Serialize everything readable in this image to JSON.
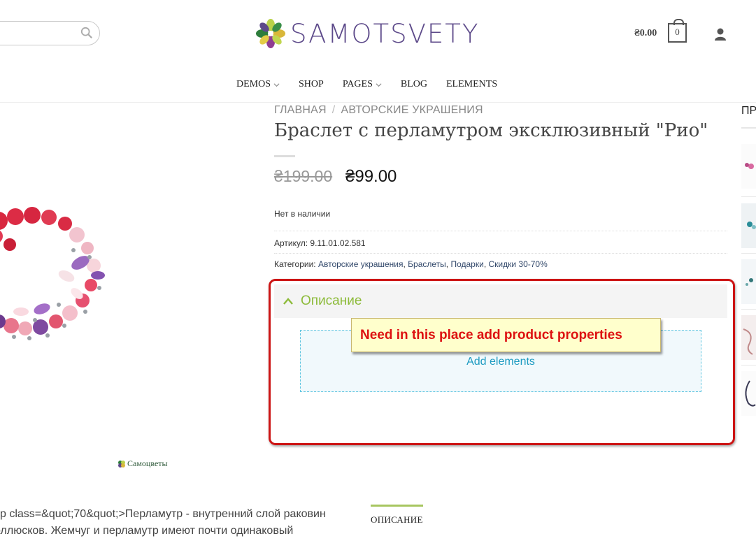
{
  "header": {
    "search": {
      "placeholder": "",
      "icon": "search-icon"
    },
    "logo_text": "SAMOTSVETY",
    "cart_total": "₴0.00",
    "cart_count": "0",
    "user_icon": "user-icon"
  },
  "nav": {
    "items": [
      {
        "label": "DEMOS",
        "has_dropdown": true
      },
      {
        "label": "SHOP",
        "has_dropdown": false
      },
      {
        "label": "PAGES",
        "has_dropdown": true
      },
      {
        "label": "BLOG",
        "has_dropdown": false
      },
      {
        "label": "ELEMENTS",
        "has_dropdown": false
      }
    ]
  },
  "product": {
    "watermark": "Самоцветы",
    "breadcrumb": {
      "home": "ГЛАВНАЯ",
      "separator": "/",
      "category": "АВТОРСКИЕ УКРАШЕНИЯ"
    },
    "title": "Браслет с перламутром эксклюзивный \"Рио\"",
    "price_old": "₴199.00",
    "price_new": "₴99.00",
    "stock": "Нет в наличии",
    "sku_label": "Артикул:",
    "sku_value": "9.11.01.02.581",
    "categories_label": "Категории:",
    "categories": [
      "Авторские украшения",
      "Браслеты",
      "Подарки",
      "Скидки 30-70%"
    ]
  },
  "accordion": {
    "title": "Описание",
    "add_elements": "Add elements"
  },
  "annotation": {
    "callout": "Need in this place add product properties"
  },
  "sidebar": {
    "heading": "ПР"
  },
  "description": {
    "line1": "p class=&quot;70&quot;>Перламутр - внутренний слой раковин",
    "line2": "оллюсков. Жемчуг и перламутр имеют почти одинаковый",
    "tab_label": "ОПИСАНИЕ"
  },
  "colors": {
    "brand": "#5d4a8a",
    "accent_green": "#8dbb3a",
    "link": "#1d9bc1",
    "annotation_red": "#cc1414"
  }
}
